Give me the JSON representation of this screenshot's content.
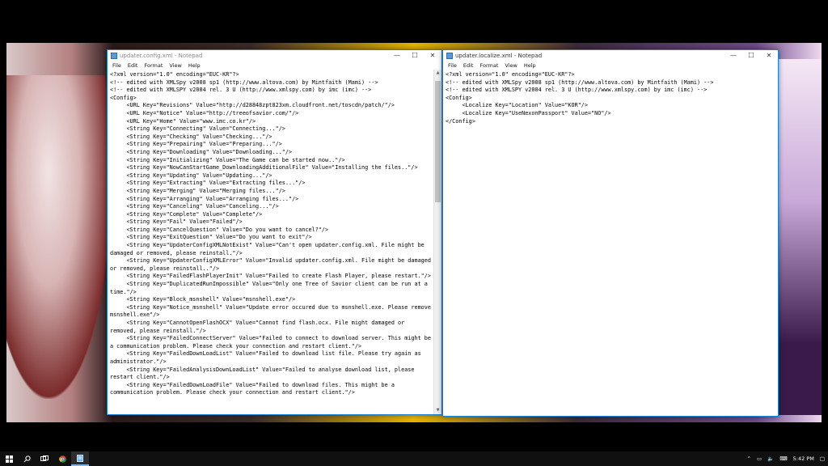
{
  "left_window": {
    "title": "updater.config.xml - Notepad",
    "menu": [
      "File",
      "Edit",
      "Format",
      "View",
      "Help"
    ],
    "content": "<?xml version=\"1.0\" encoding=\"EUC-KR\"?>\n<!-- edited with XMLSpy v2008 sp1 (http://www.altova.com) by Mintfaith (Mami) -->\n<!-- edited with XMLSPY v2004 rel. 3 U (http://www.xmlspy.com) by imc (imc) -->\n<Config>\n\t<URL Key=\"Revisions\" Value=\"http://d28848zpt823xm.cloudfront.net/toscdn/patch/\"/>\n\t<URL Key=\"Notice\" Value=\"http://treeofsavior.com/\"/>\n\t<URL Key=\"Home\" Value=\"www.imc.co.kr\"/>\n\t<String Key=\"Connecting\" Value=\"Connecting...\"/>\n\t<String Key=\"Checking\" Value=\"Checking...\"/>\n\t<String Key=\"Prepairing\" Value=\"Preparing...\"/>\n\t<String Key=\"Downloading\" Value=\"Downloading...\"/>\n\t<String Key=\"Initializing\" Value=\"The Game can be started now..\"/>\n\t<String Key=\"NowCanStartGame_DownloadingAdditionalFile\" Value=\"Installing the files..\"/>\n\t<String Key=\"Updating\" Value=\"Updating...\"/>\n\t<String Key=\"Extracting\" Value=\"Extracting files...\"/>\n\t<String Key=\"Merging\" Value=\"Merging files...\"/>\n\t<String Key=\"Arranging\" Value=\"Arranging files...\"/>\n\t<String Key=\"Canceling\" Value=\"Canceling...\"/>\n\t<String Key=\"Complete\" Value=\"Complete\"/>\n\t<String Key=\"Fail\" Value=\"Failed\"/>\n\t<String Key=\"CancelQuestion\" Value=\"Do you want to cancel?\"/>\n\t<String Key=\"ExitQuestion\" Value=\"Do you want to exit\"/>\n\t<String Key=\"UpdaterConfigXMLNotExist\" Value=\"Can't open updater.config.xml. File might be damaged or removed, please reinstall.\"/>\n\t<String Key=\"UpdaterConfigXMLError\" Value=\"Invalid updater.config.xml. File might be damaged or removed, please reinstall..\"/>\n\t<String Key=\"FailedFlashPlayerInit\" Value=\"Failed to create Flash Player, please restart.\"/>\n\t<String Key=\"DuplicatedRunImpossible\" Value=\"Only one Tree of Savior client can be run at a time.\"/>\n\t<String Key=\"Block_msnshell\" Value=\"msnshell.exe\"/>\n\t<String Key=\"Notice_msnshell\" Value=\"Update error occured due to msnshell.exe. Please remove msnshell.exe\"/>\n\t<String Key=\"CannotOpenFlashOCX\" Value=\"Cannot find flash.ocx. File might damaged or removed, please reinstall.\"/>\n\t<String Key=\"FailedConnectServer\" Value=\"Failed to connect to download server. This might be a communication problem. Please check your connection and restart client.\"/>\n\t<String Key=\"FailedDownLoadList\" Value=\"Failed to download list file. Please try again as administrator.\"/>\n\t<String Key=\"FailedAnalysisDownLoadList\" Value=\"Failed to analyse download list, please restart client.\"/>\n\t<String Key=\"FailedDownLoadFile\" Value=\"Failed to download files. This might be a communication problem. Please check your connection and restart client.\"/>"
  },
  "right_window": {
    "title": "updater.localize.xml - Notepad",
    "menu": [
      "File",
      "Edit",
      "Format",
      "View",
      "Help"
    ],
    "content": "<?xml version=\"1.0\" encoding=\"EUC-KR\"?>\n<!-- edited with XMLSpy v2008 sp1 (http://www.altova.com) by Mintfaith (Mami) -->\n<!-- edited with XMLSPY v2004 rel. 3 U (http://www.xmlspy.com) by imc (imc) -->\n<Config>\n\t<Localize Key=\"Location\" Value=\"KOR\"/>\n\t<Localize Key=\"UseNexonPassport\" Value=\"NO\"/>\n</Config>"
  },
  "taskbar": {
    "clock": "5:42 PM",
    "icons": [
      "start-icon",
      "search-icon",
      "task-view-icon",
      "chrome-icon",
      "notepad-icon"
    ]
  }
}
